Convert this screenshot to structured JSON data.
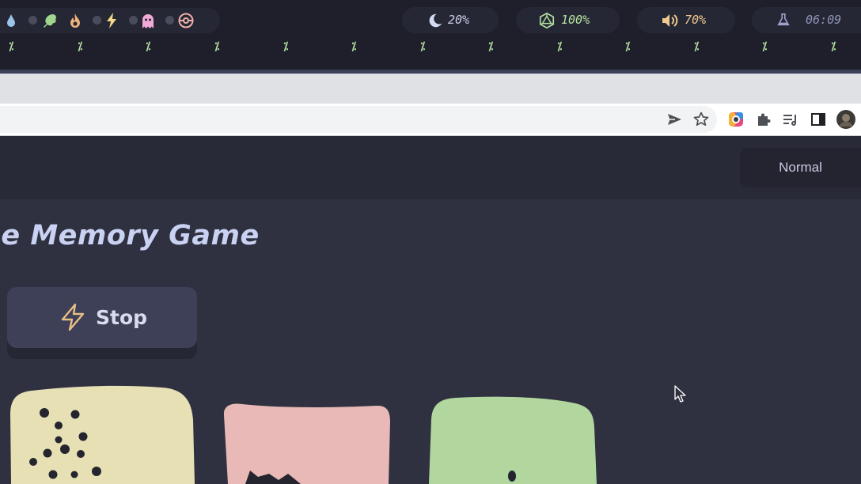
{
  "statusbar": {
    "workspace_icons": [
      "water-drop-icon",
      "leaf-icon",
      "fire-icon",
      "lightning-icon",
      "ghost-icon",
      "pokeball-icon"
    ],
    "brightness": {
      "icon": "moon-icon",
      "value": "20%"
    },
    "battery": {
      "icon": "d20-icon",
      "value": "100%"
    },
    "volume": {
      "icon": "speaker-icon",
      "value": "70%"
    },
    "clock": {
      "icon": "flask-icon",
      "time": "06:09"
    },
    "tick_marks": [
      "⁒",
      "⁒",
      "⁒",
      "⁒",
      "⁒",
      "⁒",
      "⁒",
      "⁒",
      "⁒",
      "⁒",
      "⁒",
      "⁒",
      "⁒"
    ]
  },
  "browser": {
    "toolbar_icons": [
      "send-icon",
      "bookmark-star-icon",
      "colorful-extension-icon",
      "extensions-puzzle-icon",
      "reading-list-icon",
      "side-panel-icon",
      "profile-avatar"
    ]
  },
  "page": {
    "mode_label": "Normal",
    "title": "he Memory Game",
    "stop_label": "Stop",
    "cards": [
      {
        "color": "#e6e0b4"
      },
      {
        "color": "#e8b9b6"
      },
      {
        "color": "#b1d79f"
      }
    ]
  },
  "colors": {
    "background": "#2f3040",
    "accent_green": "#b4e3a0",
    "text": "#c9cbe3"
  }
}
